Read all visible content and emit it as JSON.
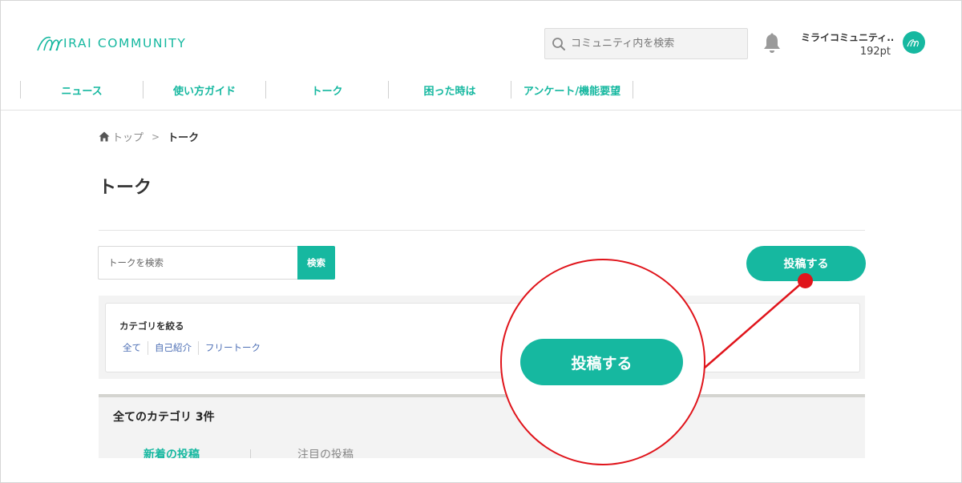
{
  "header": {
    "logo_text": "IRAI COMMUNITY",
    "search_placeholder": "コミュニティ内を検索",
    "user_name": "ミライコミュニティ...",
    "user_points": "192pt"
  },
  "nav": {
    "items": [
      {
        "label": "ニュース"
      },
      {
        "label": "使い方ガイド"
      },
      {
        "label": "トーク"
      },
      {
        "label": "困った時は"
      },
      {
        "label": "アンケート/機能要望"
      }
    ]
  },
  "breadcrumb": {
    "home": "トップ",
    "separator": ">",
    "current": "トーク"
  },
  "page": {
    "title": "トーク"
  },
  "talk_search": {
    "placeholder": "トークを検索",
    "button_label": "検索"
  },
  "post_button": {
    "label": "投稿する"
  },
  "filter": {
    "title": "カテゴリを絞る",
    "links": [
      "全て",
      "自己紹介",
      "フリートーク"
    ]
  },
  "listing": {
    "title": "全てのカテゴリ 3件",
    "tabs": [
      "新着の投稿",
      "注目の投稿"
    ]
  },
  "annotation": {
    "zoom_label": "投稿する"
  },
  "colors": {
    "brand": "#16b8a0",
    "link": "#4d6fb5",
    "annotation": "#e0141b"
  },
  "icons": {
    "search": "search-icon",
    "bell": "bell-icon",
    "home": "home-icon",
    "logo": "logo-icon"
  }
}
